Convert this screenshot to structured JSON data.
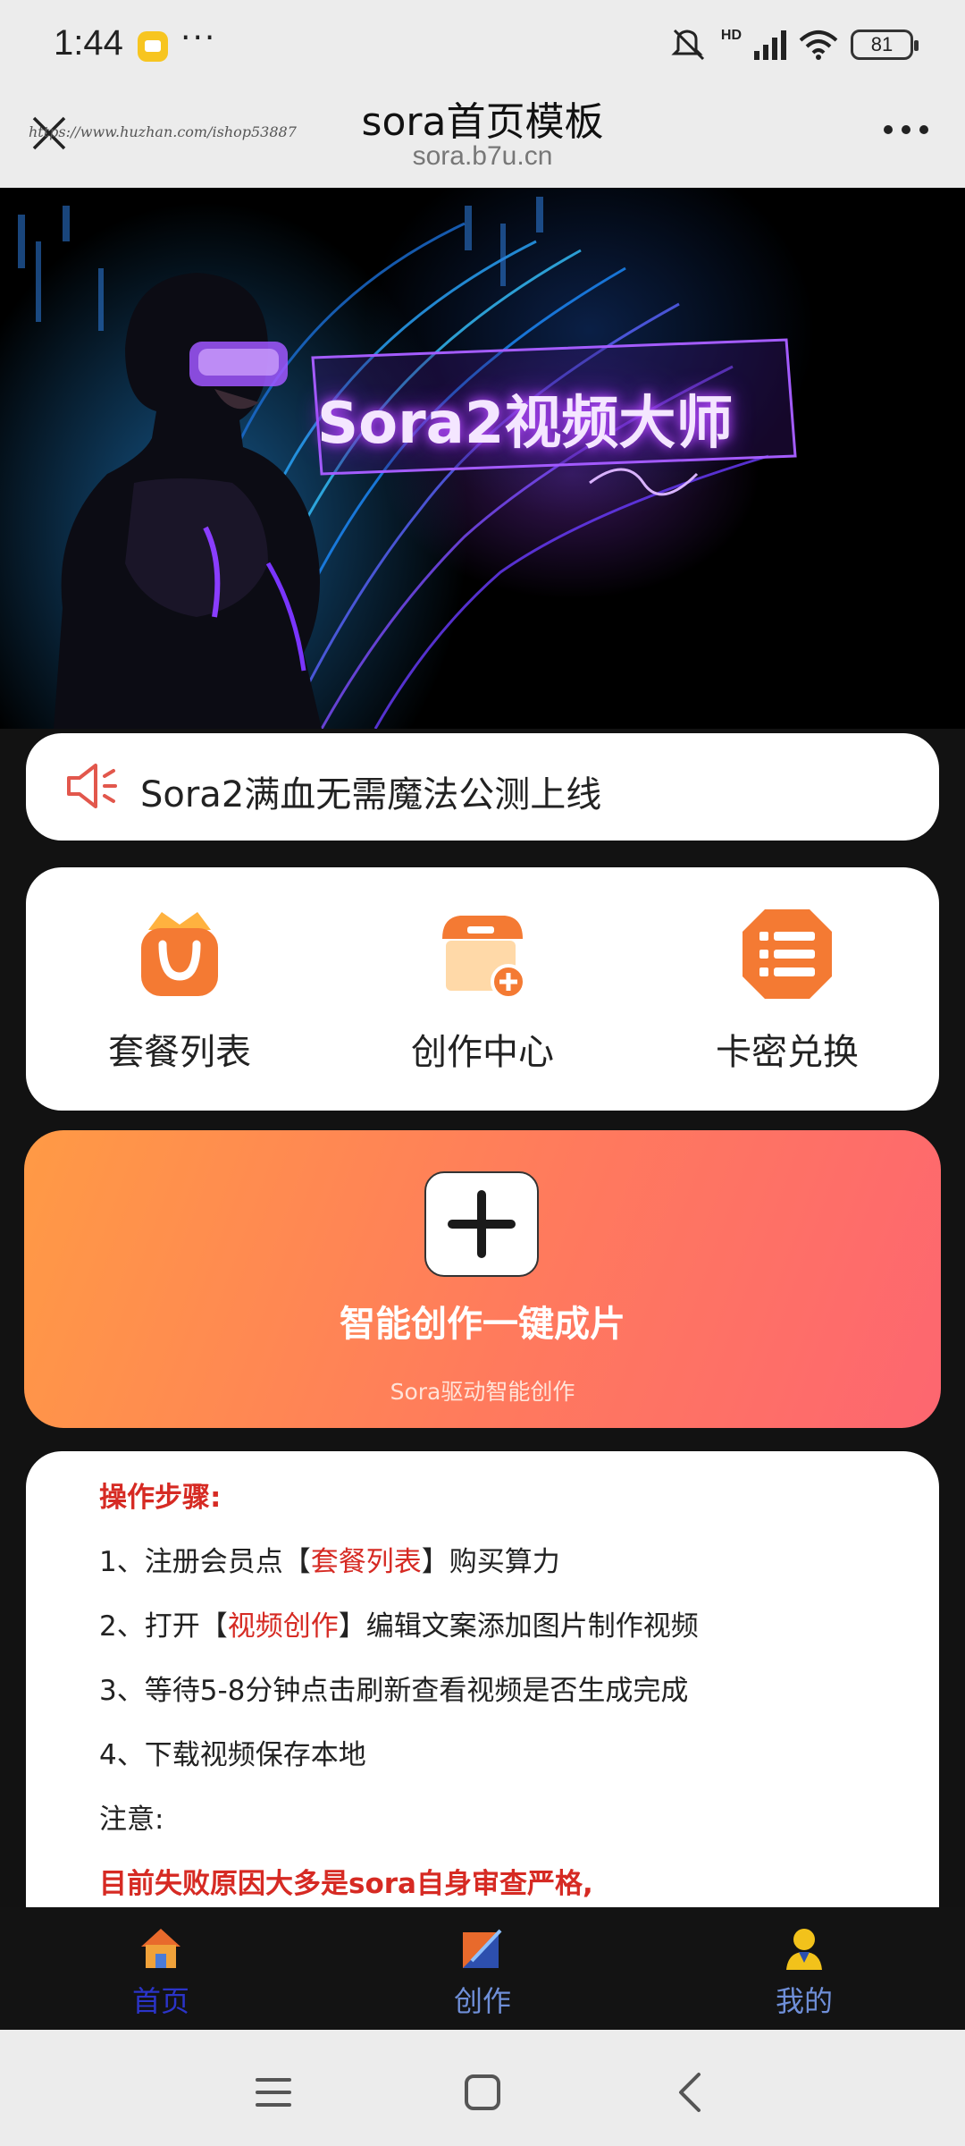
{
  "status": {
    "time": "1:44",
    "more": "···",
    "hd": "HD",
    "battery": "81"
  },
  "header": {
    "title": "sora首页模板",
    "domain": "sora.b7u.cn",
    "watermark": "https://www.huzhan.com/ishop53887"
  },
  "banner": {
    "title": "Sora2视频大师"
  },
  "notice": {
    "text": "Sora2满血无需魔法公测上线"
  },
  "quick_menu": [
    {
      "label": "套餐列表",
      "icon": "shopping-bag-icon"
    },
    {
      "label": "创作中心",
      "icon": "shop-add-icon"
    },
    {
      "label": "卡密兑换",
      "icon": "list-icon"
    }
  ],
  "create": {
    "title": "智能创作一键成片",
    "subtitle": "Sora驱动智能创作"
  },
  "steps": {
    "heading": "操作步骤:",
    "step1": {
      "pre": "1、注册会员点【",
      "link": "套餐列表",
      "post": "】购买算力"
    },
    "step2": {
      "pre": "2、打开【",
      "link": "视频创作",
      "post": "】编辑文案添加图片制作视频"
    },
    "step3": "3、等待5-8分钟点击刷新查看视频是否生成完成",
    "step4": "4、下载视频保存本地",
    "note": "注意:",
    "warning": "目前失败原因大多是sora自身审查严格,"
  },
  "tabbar": [
    {
      "label": "首页",
      "icon": "home-icon",
      "active": true
    },
    {
      "label": "创作",
      "icon": "create-icon",
      "active": false
    },
    {
      "label": "我的",
      "icon": "user-icon",
      "active": false
    }
  ],
  "colors": {
    "accent_orange": "#f47a33",
    "gradient_start": "#ff9a45",
    "gradient_end": "#fd6670",
    "warning_red": "#d62a23",
    "tab_active": "#2b34c9",
    "tab_inactive": "#6f8fd8"
  }
}
